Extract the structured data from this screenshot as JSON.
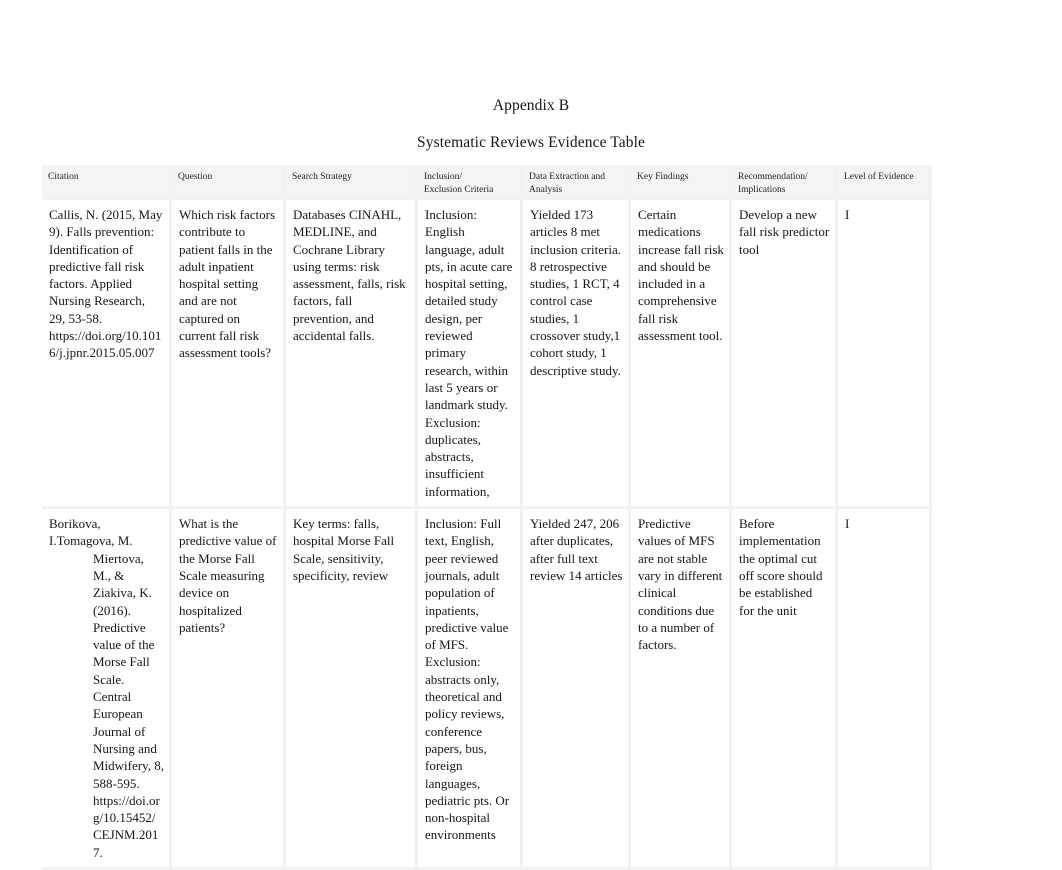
{
  "document": {
    "title": "Appendix B",
    "subtitle": "Systematic Reviews Evidence Table"
  },
  "table": {
    "headers": [
      "Citation",
      "Question",
      "Search Strategy",
      "Inclusion/\nExclusion Criteria",
      "Data Extraction and\nAnalysis",
      "Key Findings",
      "Recommendation/\nImplications",
      "Level of Evidence"
    ],
    "rows": [
      {
        "citation": "Callis, N. (2015, May 9). Falls prevention: Identification of predictive fall risk factors. Applied Nursing Research, 29, 53-58. https://doi.org/10.1016/j.jpnr.2015.05.007",
        "citation_first_line": "",
        "citation_rest": "",
        "question": "Which risk factors contribute to patient falls in the adult inpatient hospital setting and are not captured on current fall risk assessment tools?",
        "search_strategy": "Databases CINAHL, MEDLINE, and Cochrane Library using terms: risk assessment, falls, risk factors, fall prevention, and accidental falls.",
        "criteria": "Inclusion: English language, adult pts, in acute care hospital setting, detailed study design, per reviewed primary research, within last 5 years or landmark study. Exclusion: duplicates, abstracts, insufficient information,",
        "data_extraction": "Yielded 173 articles 8 met inclusion criteria. 8 retrospective studies, 1 RCT, 4 control case studies, 1 crossover study,1 cohort study, 1 descriptive study.",
        "key_findings": "Certain medications increase fall risk and should be included in a comprehensive fall risk assessment tool.",
        "recommendation": "Develop a new fall risk predictor tool",
        "level_of_evidence": "I"
      },
      {
        "citation": "",
        "citation_first_line": "Borikova, I.Tomagova, M.",
        "citation_rest": "Miertova, M., & Ziakiva, K. (2016). Predictive value of the Morse Fall Scale. Central European Journal of Nursing and Midwifery, 8, 588-595. https://doi.org/10.15452/CEJNM.2017.",
        "question": "What is the predictive value of the Morse Fall Scale measuring device on hospitalized patients?",
        "search_strategy": "Key terms: falls, hospital Morse Fall Scale, sensitivity, specificity, review",
        "criteria": "Inclusion: Full text, English, peer reviewed journals, adult population of inpatients, predictive value of MFS. Exclusion: abstracts only, theoretical and policy reviews, conference papers, bus, foreign languages, pediatric pts. Or non-hospital environments",
        "data_extraction": "Yielded 247, 206 after duplicates, after full text review 14 articles",
        "key_findings": "Predictive values of MFS are not stable vary in different clinical conditions due to a number of factors.",
        "recommendation": "Before implementation the optimal cut off score should be established for the unit",
        "level_of_evidence": "I"
      }
    ]
  }
}
